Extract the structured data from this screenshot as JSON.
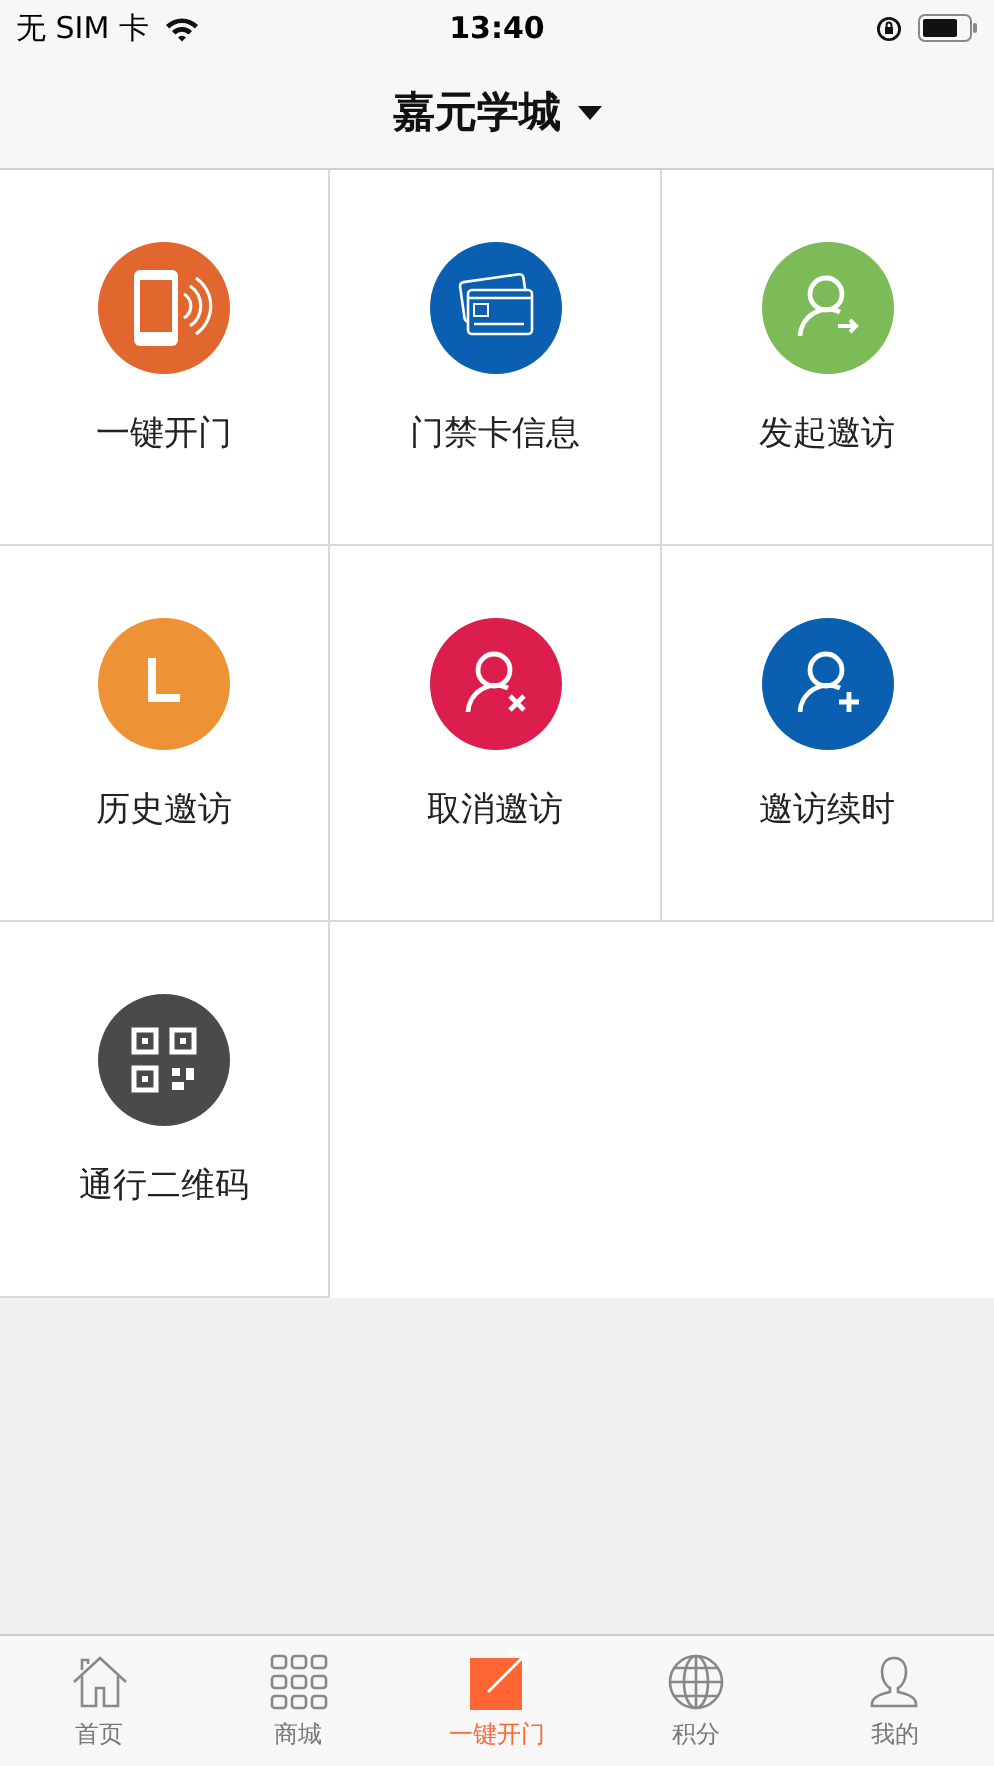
{
  "status_bar": {
    "carrier": "无 SIM 卡",
    "time": "13:40"
  },
  "header": {
    "title": "嘉元学城",
    "dropdown": true
  },
  "tiles": [
    {
      "label": "一键开门",
      "kind": "phone",
      "color": "#e2672f"
    },
    {
      "label": "门禁卡信息",
      "kind": "card",
      "color": "#0b5fb0"
    },
    {
      "label": "发起邀访",
      "kind": "invite",
      "color": "#7dba58"
    },
    {
      "label": "历史邀访",
      "kind": "clock",
      "color": "#ee9236"
    },
    {
      "label": "取消邀访",
      "kind": "cancel",
      "color": "#db1e4b"
    },
    {
      "label": "邀访续时",
      "kind": "renew",
      "color": "#0b5fb0"
    },
    {
      "label": "通行二维码",
      "kind": "qr",
      "color": "#4a4a4a"
    }
  ],
  "tab_bar": [
    {
      "label": "首页",
      "kind": "home",
      "selected": false
    },
    {
      "label": "商城",
      "kind": "grid",
      "selected": false
    },
    {
      "label": "一键开门",
      "kind": "open",
      "selected": true
    },
    {
      "label": "积分",
      "kind": "globe",
      "selected": false
    },
    {
      "label": "我的",
      "kind": "user",
      "selected": false
    }
  ]
}
